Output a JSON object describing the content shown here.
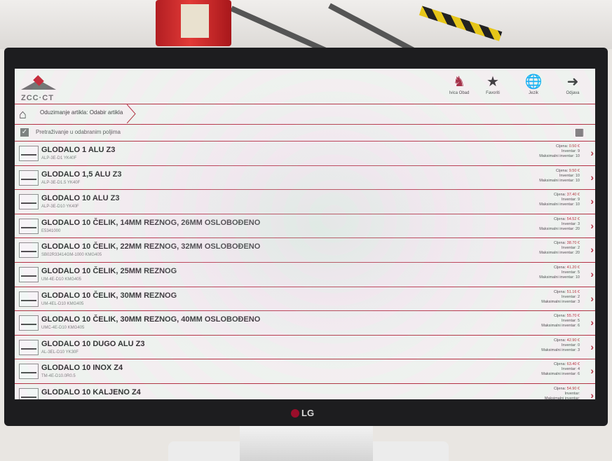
{
  "toolbar": {
    "user_label": "Ivica Obad",
    "favorites_label": "Favoriti",
    "language_label": "Jezik",
    "logout_label": "Odjava"
  },
  "brand": {
    "name": "ZCC·CT"
  },
  "breadcrumb": {
    "text": "Oduzimanje artikla: Odabir artikla"
  },
  "filter": {
    "label": "Pretraživanje u odabranim poljima"
  },
  "labels": {
    "price": "Cijena:",
    "inventory": "Inventar:",
    "max_inventory": "Maksimalni inventar:"
  },
  "items": [
    {
      "name": "GLODALO 1 ALU Z3",
      "code": "ALP-3E-D1 YK40F",
      "price": "0.50 €",
      "inventory": "9",
      "max_inventory": "10"
    },
    {
      "name": "GLODALO 1,5 ALU Z3",
      "code": "ALP-3E-D1.5 YK40F",
      "price": "9.50 €",
      "inventory": "10",
      "max_inventory": "10"
    },
    {
      "name": "GLODALO 10 ALU Z3",
      "code": "ALP-3E-D10 YK40F",
      "price": "37.40 €",
      "inventory": "9",
      "max_inventory": "10"
    },
    {
      "name": "GLODALO 10 ČELIK, 14MM REZNOG, 26MM OSLOBOĐENO",
      "code": "E5341000",
      "price": "54.52 €",
      "inventory": "3",
      "max_inventory": "20"
    },
    {
      "name": "GLODALO 10 ČELIK, 22MM REZNOG, 32MM OSLOBOĐENO",
      "code": "SB02R33414GM-1000 KMG405",
      "price": "38.70 €",
      "inventory": "2",
      "max_inventory": "20"
    },
    {
      "name": "GLODALO 10 ČELIK, 25MM REZNOG",
      "code": "UM-4E-D10 KMG405",
      "price": "41.20 €",
      "inventory": "5",
      "max_inventory": "10"
    },
    {
      "name": "GLODALO 10 ČELIK, 30MM REZNOG",
      "code": "UM-4EL-D10 KMG405",
      "price": "51.16 €",
      "inventory": "2",
      "max_inventory": "3"
    },
    {
      "name": "GLODALO 10 ČELIK, 30MM REZNOG, 40MM OSLOBOĐENO",
      "code": "UMC-4E-D10 KMG405",
      "price": "55.70 €",
      "inventory": "5",
      "max_inventory": "6"
    },
    {
      "name": "GLODALO 10 DUGO ALU Z3",
      "code": "AL-3EL-D10 YK30F",
      "price": "42.90 €",
      "inventory": "0",
      "max_inventory": "3"
    },
    {
      "name": "GLODALO 10 INOX Z4",
      "code": "TM-4E-D10.0R0.5",
      "price": "63.40 €",
      "inventory": "4",
      "max_inventory": "6"
    },
    {
      "name": "GLODALO 10 KALJENO Z4",
      "code": "",
      "price": "54.90 €",
      "inventory": "",
      "max_inventory": ""
    }
  ],
  "monitor_brand": "LG"
}
